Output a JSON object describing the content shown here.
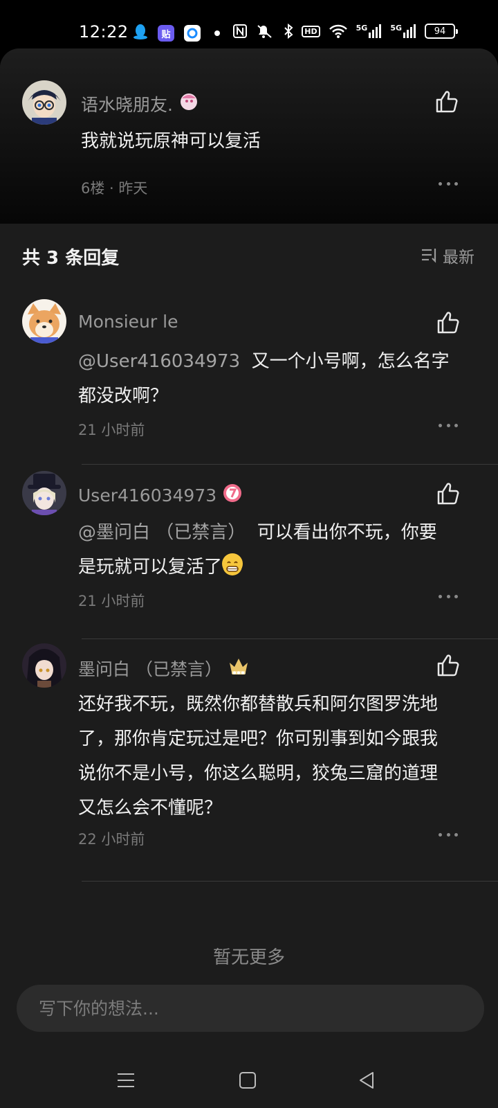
{
  "status_bar": {
    "time": "12:22",
    "battery": "94",
    "app_icons": [
      "qq-icon",
      "tieba-icon",
      "browser-icon"
    ],
    "system_icons": [
      "nfc-icon",
      "mute-icon",
      "bluetooth-icon",
      "hd-icon",
      "wifi-icon",
      "signal-5g-icon",
      "signal-5g-icon"
    ],
    "network_1": "5G",
    "network_2": "5G",
    "hd_label": "HD"
  },
  "parent_comment": {
    "username": "语水晓朋友.",
    "content": "我就说玩原神可以复活",
    "meta": "6楼 · 昨天"
  },
  "replies_header": {
    "title": "共 3 条回复",
    "sort_label": "最新"
  },
  "replies": [
    {
      "username": "Monsieur le",
      "mention": "@User416034973",
      "text_line1": "又一个小号啊，怎么名字",
      "text_line2": "都没改啊？",
      "time": "21 小时前"
    },
    {
      "username": "User416034973",
      "mention": "@墨问白 （已禁言）",
      "text_line1": "可以看出你不玩，你要",
      "text_line2": "是玩就可以复活了",
      "time": "21 小时前"
    },
    {
      "username": "墨问白 （已禁言）",
      "text_line1": "还好我不玩，既然你都替散兵和阿尔图罗洗地",
      "text_line2": "了，那你肯定玩过是吧？你可别事到如今跟我",
      "text_line3": "说你不是小号，你这么聪明，狡兔三窟的道理",
      "text_line4": "又怎么会不懂呢？",
      "time": "22 小时前"
    }
  ],
  "footer": {
    "no_more": "暂无更多",
    "input_placeholder": "写下你的想法..."
  },
  "colors": {
    "background": "#1c1c1c",
    "accent_badge": "#f06b8a",
    "crown": "#e9c46a"
  }
}
